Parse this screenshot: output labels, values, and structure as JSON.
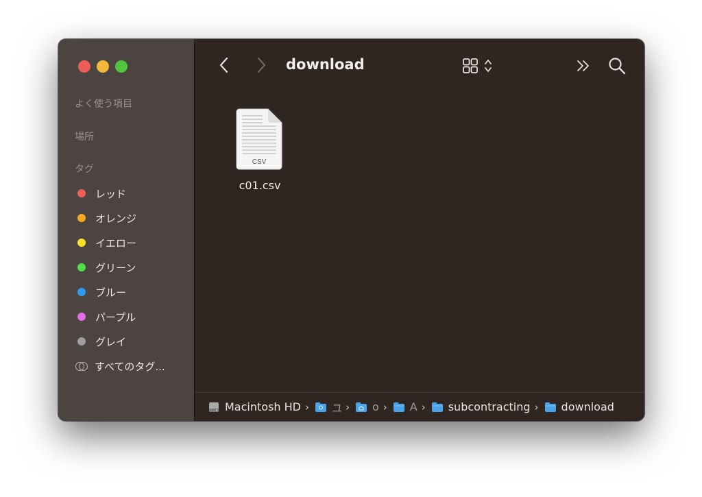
{
  "window": {
    "title": "download"
  },
  "sidebar": {
    "sections": {
      "favorites": "よく使う項目",
      "locations": "場所",
      "tags": "タグ"
    },
    "tags": [
      {
        "label": "レッド",
        "color": "#ee5e57"
      },
      {
        "label": "オレンジ",
        "color": "#f5a623"
      },
      {
        "label": "イエロー",
        "color": "#f8e327"
      },
      {
        "label": "グリーン",
        "color": "#4fe04a"
      },
      {
        "label": "ブルー",
        "color": "#2e9bf0"
      },
      {
        "label": "パープル",
        "color": "#e36ee6"
      },
      {
        "label": "グレイ",
        "color": "#9e9e9e"
      }
    ],
    "all_tags": "すべてのタグ..."
  },
  "toolbar": {
    "back_icon": "chevron-left-icon",
    "forward_icon": "chevron-right-icon",
    "view_icon": "grid-view-icon",
    "more_icon": "double-chevron-icon",
    "search_icon": "search-icon"
  },
  "files": [
    {
      "name": "c01.csv",
      "type_label": "CSV"
    }
  ],
  "pathbar": {
    "items": [
      {
        "label": "Macintosh HD",
        "icon": "hard-drive-icon"
      },
      {
        "label": "ユ",
        "icon": "users-folder-icon"
      },
      {
        "label": "o",
        "icon": "home-folder-icon"
      },
      {
        "label": "A",
        "icon": "folder-icon"
      },
      {
        "label": "subcontracting",
        "icon": "folder-icon"
      },
      {
        "label": "download",
        "icon": "folder-icon"
      }
    ]
  }
}
